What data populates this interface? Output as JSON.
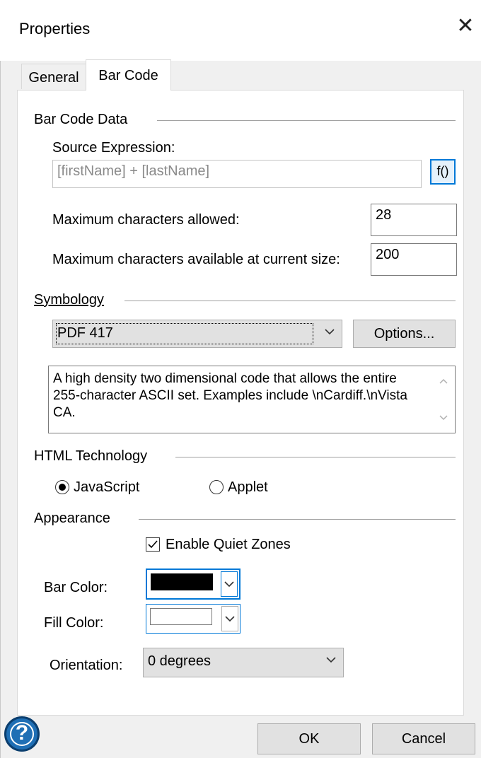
{
  "window": {
    "title": "Properties",
    "close_glyph": "✕"
  },
  "tabs": [
    {
      "label": "General"
    },
    {
      "label": "Bar Code"
    }
  ],
  "bar_code_data": {
    "section": "Bar Code Data",
    "source_label": "Source Expression:",
    "source_value": "[firstName] + [lastName]",
    "fx_label": "f()",
    "max_allowed_label": "Maximum characters allowed:",
    "max_allowed_value": "28",
    "max_available_label": "Maximum characters available at current size:",
    "max_available_value": "200"
  },
  "symbology": {
    "section": "Symbology",
    "selected": "PDF 417",
    "options_button": "Options...",
    "description": "A high density two dimensional code that allows the entire 255-character ASCII set.  Examples include \\nCardiff.\\nVista CA."
  },
  "html_technology": {
    "section": "HTML Technology",
    "javascript_label": "JavaScript",
    "applet_label": "Applet",
    "selected": "JavaScript"
  },
  "appearance": {
    "section": "Appearance",
    "quiet_zones_label": "Enable Quiet Zones",
    "quiet_zones_checked": true,
    "bar_color_label": "Bar Color:",
    "bar_color": "#000000",
    "fill_color_label": "Fill Color:",
    "fill_color": "#ffffff",
    "orientation_label": "Orientation:",
    "orientation_value": "0 degrees"
  },
  "footer": {
    "help_glyph": "?",
    "ok": "OK",
    "cancel": "Cancel"
  },
  "colors": {
    "accent": "#0078d7",
    "help_blue": "#1f6fb5"
  }
}
